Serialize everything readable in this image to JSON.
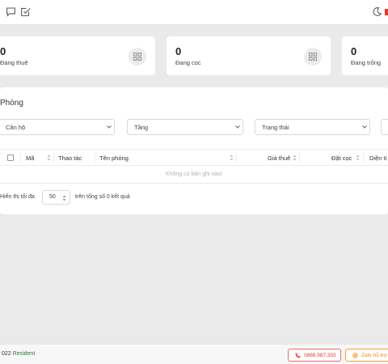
{
  "topbar": {
    "icons": [
      "chat-icon",
      "task-check-icon",
      "moon-icon"
    ]
  },
  "stats": [
    {
      "value": "0",
      "label": "Đang thuê",
      "icon": "grid-icon"
    },
    {
      "value": "0",
      "label": "Đang cọc",
      "icon": "grid-icon"
    },
    {
      "value": "0",
      "label": "Đang trống",
      "icon": "grid-icon"
    }
  ],
  "rooms": {
    "title": "Phòng",
    "filters": {
      "apartment": "Căn hộ",
      "floor": "Tầng",
      "status": "Trạng thái"
    },
    "columns": {
      "code": "Mã",
      "actions": "Thao tác",
      "room_name": "Tên phòng",
      "rent": "Giá thuê",
      "deposit": "Đặt cọc",
      "area": "Diện tí"
    },
    "empty_message": "Không có bản ghi nào!",
    "pagination": {
      "show_label": "Hiển thị tối đa",
      "page_size": "50",
      "total_label": "trên tổng số 0 kết quả"
    }
  },
  "footer": {
    "copyright_prefix": "022",
    "brand": "Resident",
    "phone": "0868.987.355",
    "zalo": "Zalo hỗ trợ"
  }
}
